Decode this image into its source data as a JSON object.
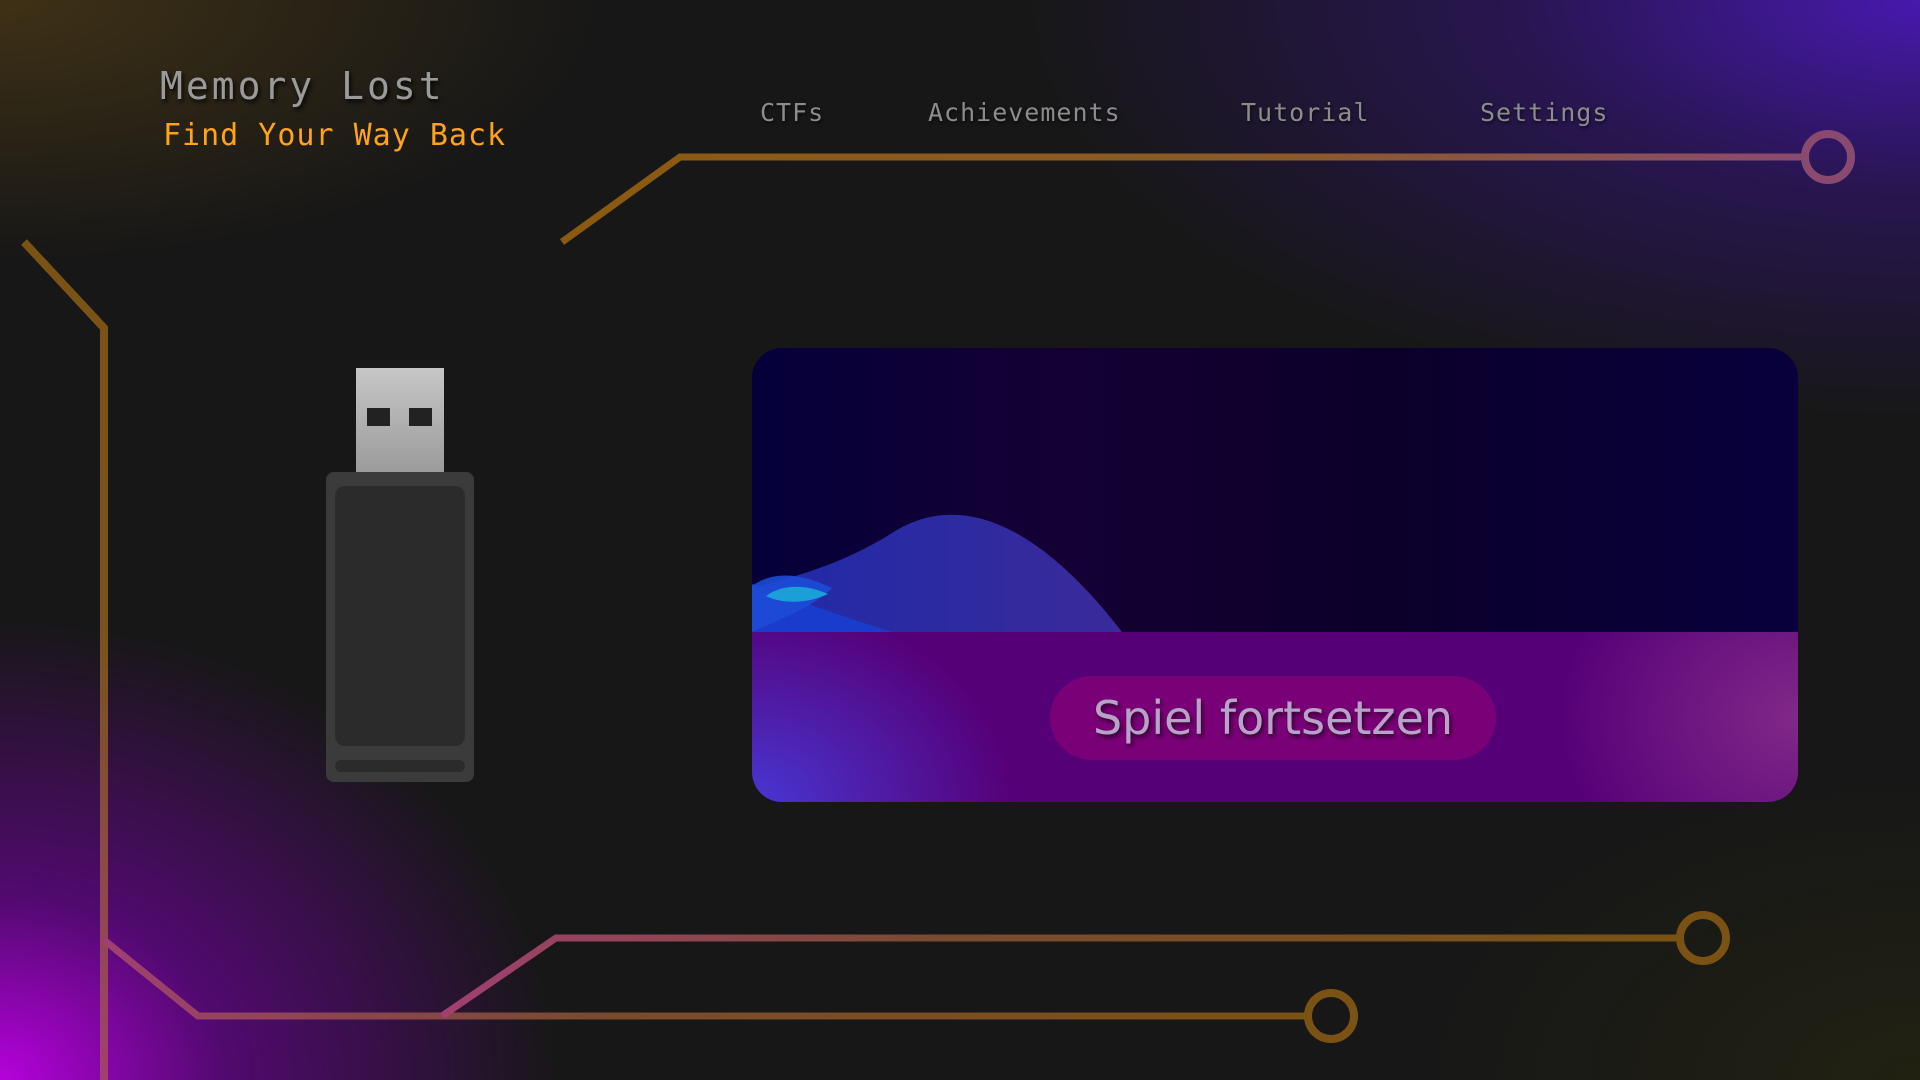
{
  "header": {
    "title": "Memory Lost",
    "subtitle": "Find Your Way Back"
  },
  "nav": {
    "items": [
      {
        "label": "CTFs"
      },
      {
        "label": "Achievements"
      },
      {
        "label": "Tutorial"
      },
      {
        "label": "Settings"
      }
    ]
  },
  "main": {
    "continue_label": "Spiel fortsetzen",
    "icon": "usb-drive-icon"
  },
  "colors": {
    "circuit": "#7a5214",
    "subtitle": "#ffa31a",
    "accent_purple": "#560078",
    "button": "#7a0077"
  }
}
